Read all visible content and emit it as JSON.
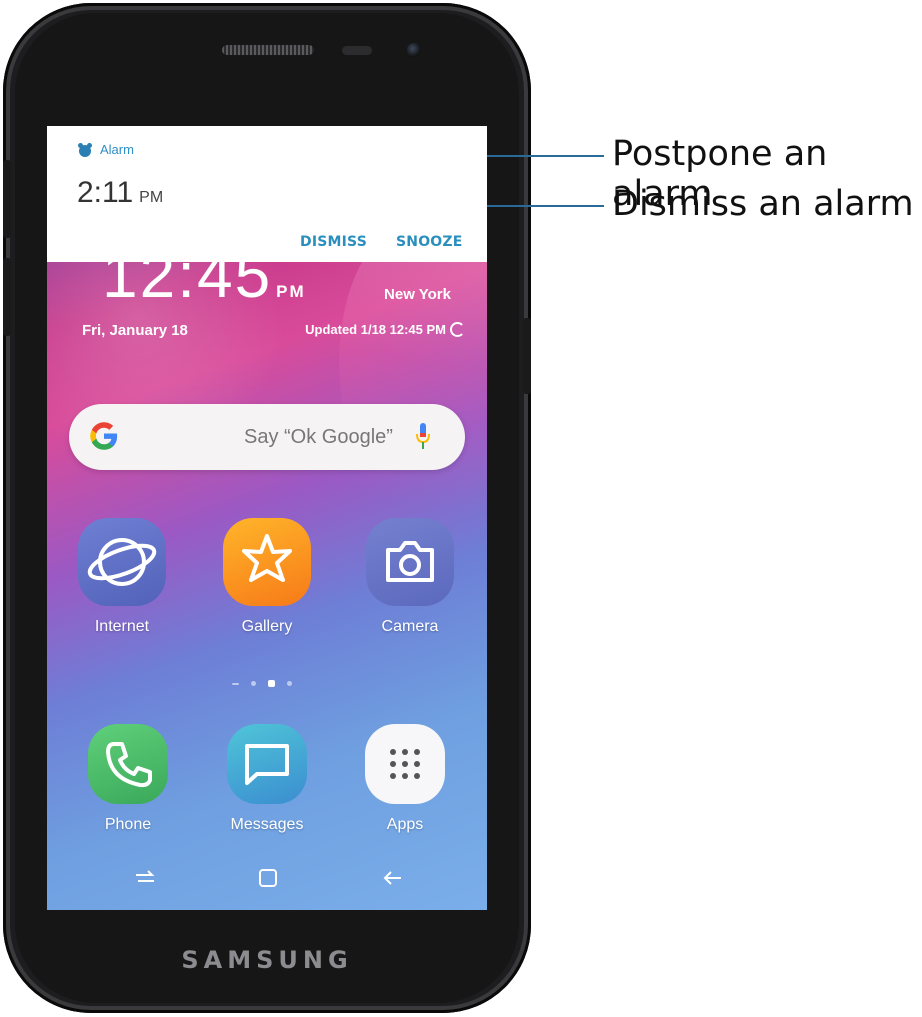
{
  "phone": {
    "brand": "SAMSUNG"
  },
  "notification": {
    "app_name": "Alarm",
    "time": "2:11",
    "ampm": "PM",
    "dismiss_label": "DISMISS",
    "snooze_label": "SNOOZE",
    "accent_color": "#2b8fbe"
  },
  "clock_widget": {
    "time": "12:45",
    "ampm": "PM",
    "date": "Fri, January 18",
    "city": "New York",
    "updated": "Updated 1/18 12:45 PM"
  },
  "search": {
    "placeholder": "Say “Ok Google”"
  },
  "home_apps": [
    {
      "label": "Internet",
      "icon": "internet-icon"
    },
    {
      "label": "Gallery",
      "icon": "gallery-icon"
    },
    {
      "label": "Camera",
      "icon": "camera-icon"
    }
  ],
  "dock_apps": [
    {
      "label": "Phone",
      "icon": "phone-icon"
    },
    {
      "label": "Messages",
      "icon": "messages-icon"
    },
    {
      "label": "Apps",
      "icon": "apps-icon"
    }
  ],
  "navigation": [
    "recents-icon",
    "home-icon",
    "back-icon"
  ],
  "callouts": {
    "postpone": "Postpone an alarm",
    "dismiss": "Dismiss an alarm",
    "line_color": "#2a6a98"
  }
}
